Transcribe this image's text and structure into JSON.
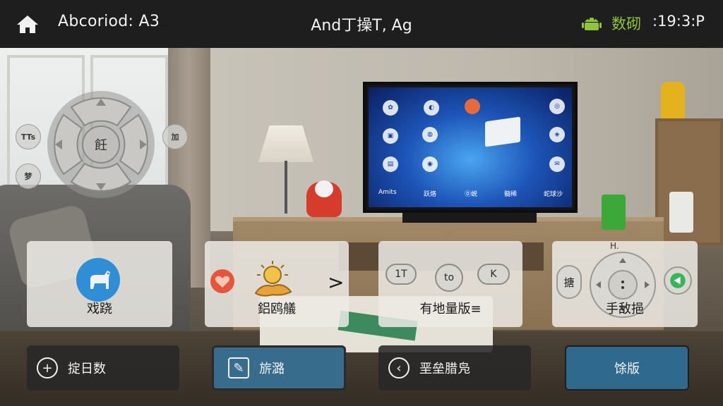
{
  "top_bar": {
    "home_icon": "home-icon",
    "title": "Abcoriod: A3",
    "center_title": "And丁操T, Ag",
    "status_icon": "android-icon",
    "status_label": "数砌",
    "time": ":19:3:P",
    "status_color": "#8fc43c"
  },
  "tv_screen": {
    "labels": [
      "Amits",
      "跃烙",
      "⓪蜕",
      "髓稀",
      "蛇球沙"
    ]
  },
  "remote_overlay": {
    "dpad_center": "飪",
    "left_top_button": "TTs",
    "left_bottom_button": "梦",
    "right_button": "加"
  },
  "cards": [
    {
      "label": "戏跷",
      "icon": "goat-icon"
    },
    {
      "label": "鋁鸥艤",
      "icon": "sun-icon",
      "arrow": ">"
    },
    {
      "label": "有地量版≡",
      "keys": [
        "1T",
        "to",
        "K"
      ]
    },
    {
      "label": "手敌挹",
      "side_key": "搪",
      "top_label": "H.",
      "icon": "play-icon"
    }
  ],
  "bottom_actions": {
    "add_label": "掟日数",
    "edit_label": "旂潞",
    "back_label": "垩垒腊凫",
    "primary_label": "馀版"
  },
  "colors": {
    "accent_blue": "#386c8c",
    "primary_blue": "#2f6a8e",
    "android_green": "#8fc43c"
  }
}
